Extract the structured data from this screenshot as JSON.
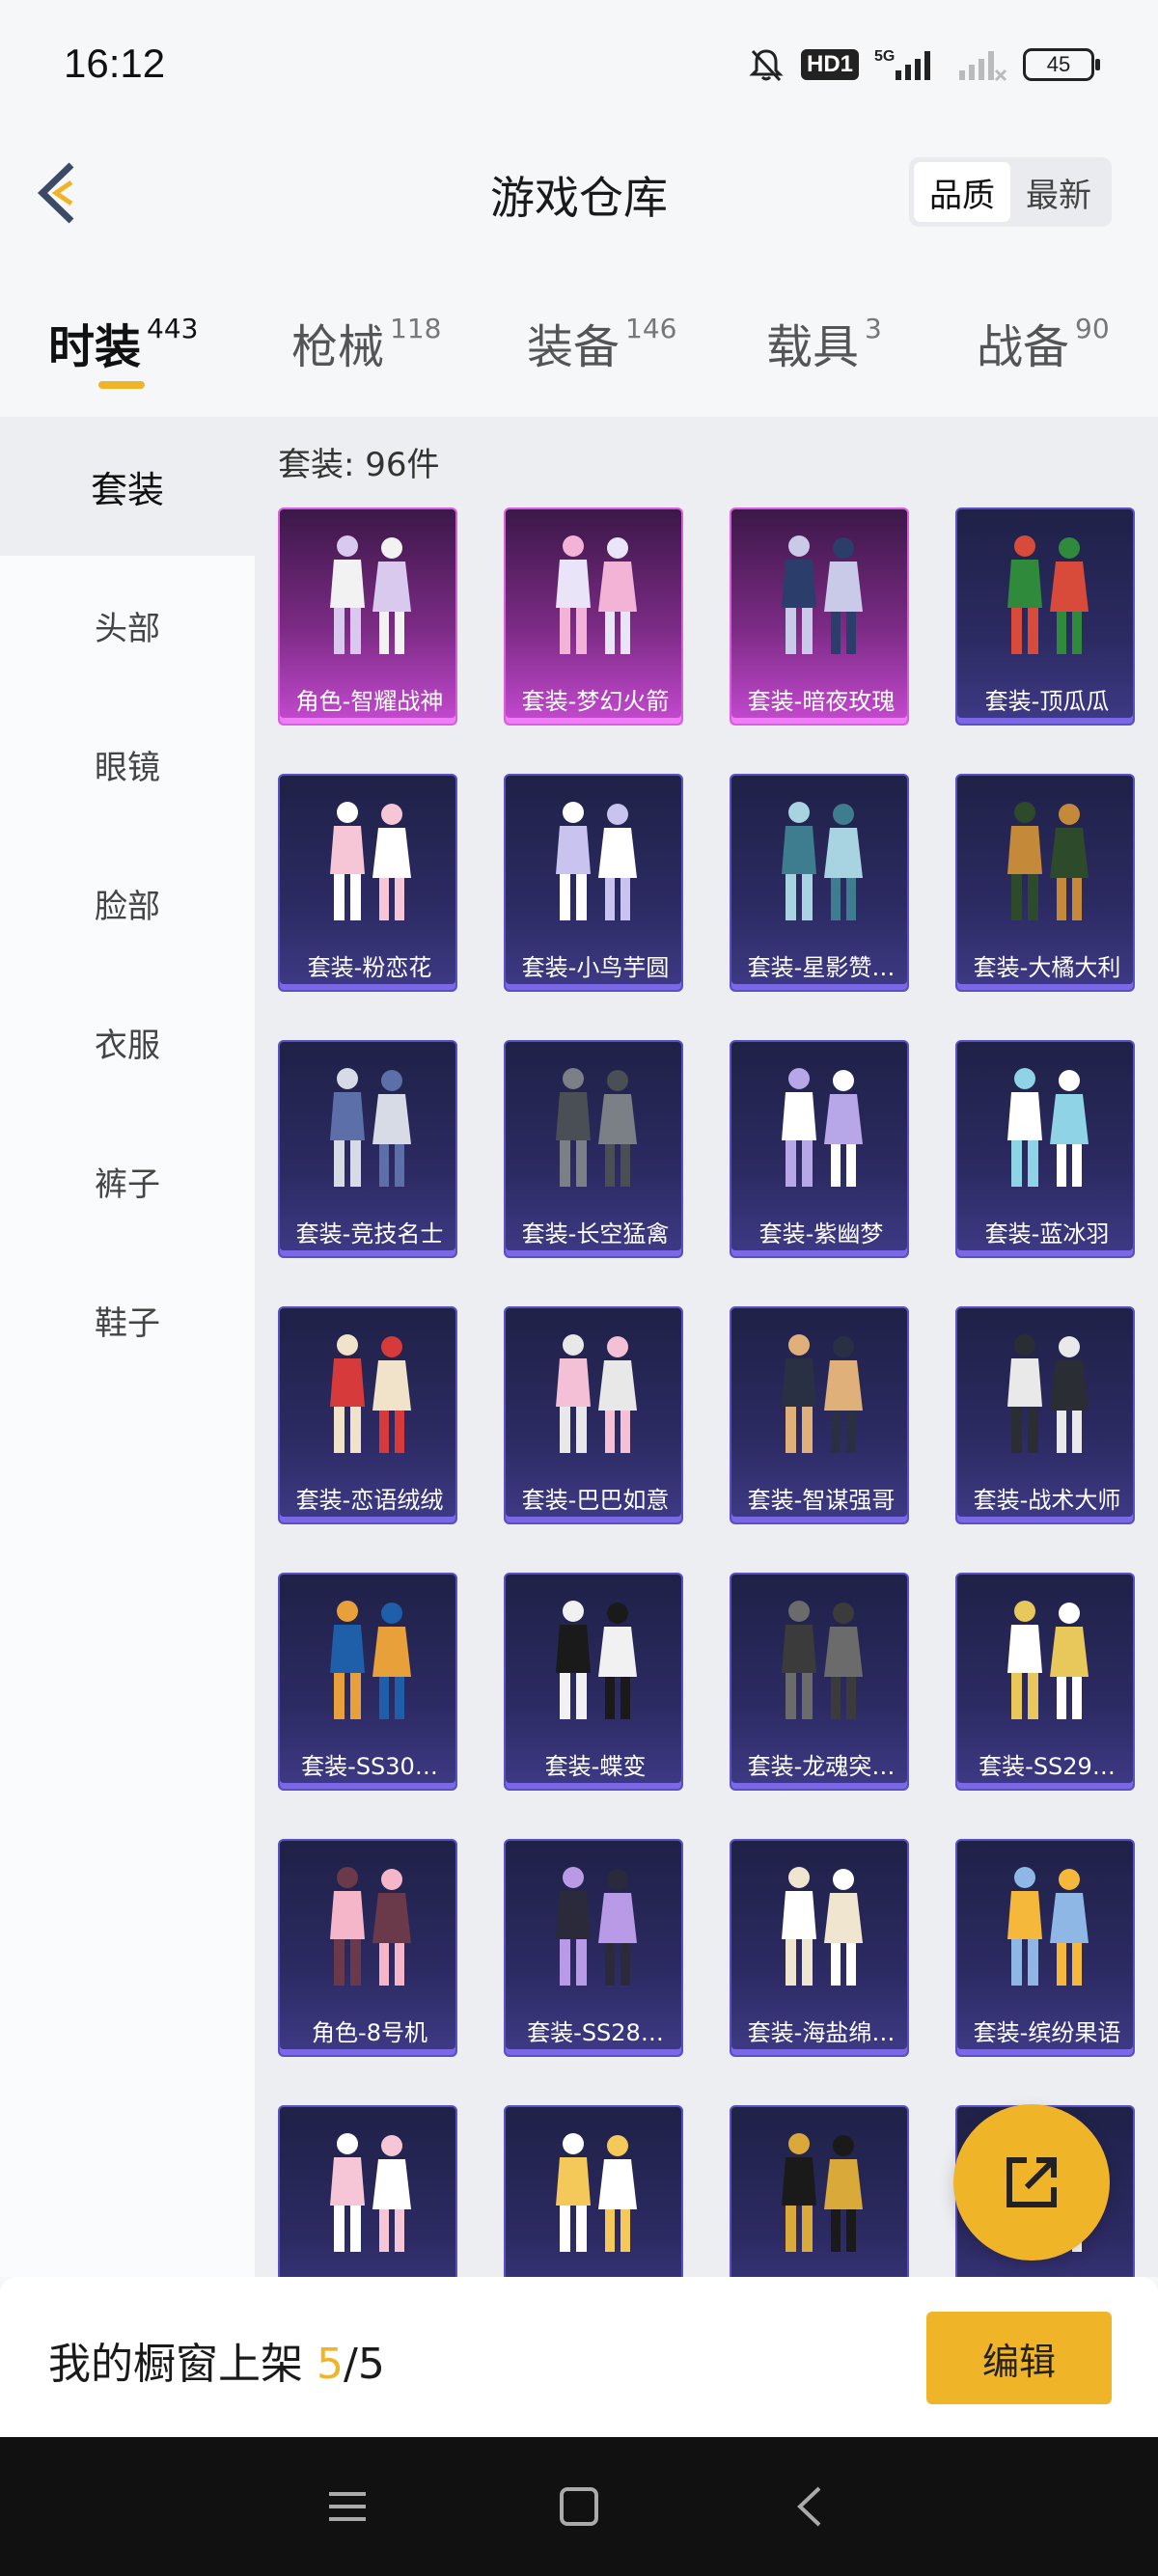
{
  "status_bar": {
    "time": "16:12",
    "hd_label": "HD1",
    "network": "5G",
    "battery": "45"
  },
  "header": {
    "title": "游戏仓库",
    "sort_options": [
      "品质",
      "最新"
    ],
    "active_sort": "品质"
  },
  "tabs": [
    {
      "label": "时装",
      "count": "443",
      "active": true
    },
    {
      "label": "枪械",
      "count": "118",
      "active": false
    },
    {
      "label": "装备",
      "count": "146",
      "active": false
    },
    {
      "label": "载具",
      "count": "3",
      "active": false
    },
    {
      "label": "战备",
      "count": "90",
      "active": false
    }
  ],
  "sidebar": {
    "items": [
      {
        "label": "套装",
        "active": true
      },
      {
        "label": "头部",
        "active": false
      },
      {
        "label": "眼镜",
        "active": false
      },
      {
        "label": "脸部",
        "active": false
      },
      {
        "label": "衣服",
        "active": false
      },
      {
        "label": "裤子",
        "active": false
      },
      {
        "label": "鞋子",
        "active": false
      }
    ]
  },
  "grid": {
    "heading": "套装: 96件",
    "items": [
      {
        "name": "角色-智耀战神",
        "rarity": "legend"
      },
      {
        "name": "套装-梦幻火箭",
        "rarity": "legend"
      },
      {
        "name": "套装-暗夜玫瑰",
        "rarity": "legend"
      },
      {
        "name": "套装-顶瓜瓜",
        "rarity": "epic"
      },
      {
        "name": "套装-粉恋花",
        "rarity": "epic"
      },
      {
        "name": "套装-小鸟芋圆",
        "rarity": "epic"
      },
      {
        "name": "套装-星影赞…",
        "rarity": "epic"
      },
      {
        "name": "套装-大橘大利",
        "rarity": "epic"
      },
      {
        "name": "套装-竞技名士",
        "rarity": "epic"
      },
      {
        "name": "套装-长空猛禽",
        "rarity": "epic"
      },
      {
        "name": "套装-紫幽梦",
        "rarity": "epic"
      },
      {
        "name": "套装-蓝冰羽",
        "rarity": "epic"
      },
      {
        "name": "套装-恋语绒绒",
        "rarity": "epic"
      },
      {
        "name": "套装-巴巴如意",
        "rarity": "epic"
      },
      {
        "name": "套装-智谋强哥",
        "rarity": "epic"
      },
      {
        "name": "套装-战术大师",
        "rarity": "epic"
      },
      {
        "name": "套装-SS30…",
        "rarity": "epic"
      },
      {
        "name": "套装-蝶变",
        "rarity": "epic"
      },
      {
        "name": "套装-龙魂突…",
        "rarity": "epic"
      },
      {
        "name": "套装-SS29…",
        "rarity": "epic"
      },
      {
        "name": "角色-8号机",
        "rarity": "epic"
      },
      {
        "name": "套装-SS28…",
        "rarity": "epic"
      },
      {
        "name": "套装-海盐绵…",
        "rarity": "epic"
      },
      {
        "name": "套装-缤纷果语",
        "rarity": "epic"
      },
      {
        "name": "",
        "rarity": "epic"
      },
      {
        "name": "",
        "rarity": "epic"
      },
      {
        "name": "",
        "rarity": "epic"
      },
      {
        "name": "",
        "rarity": "epic"
      }
    ]
  },
  "bottom_bar": {
    "label": "我的橱窗上架 ",
    "count_current": "5",
    "count_total": "/5",
    "edit_label": "编辑"
  },
  "colors": {
    "accent": "#f0b429",
    "legend": "#c54ad0",
    "epic": "#5b4fc4"
  },
  "icons": {
    "back": "chevron-left-icon",
    "share": "share-export-icon",
    "mute": "bell-off-icon"
  }
}
